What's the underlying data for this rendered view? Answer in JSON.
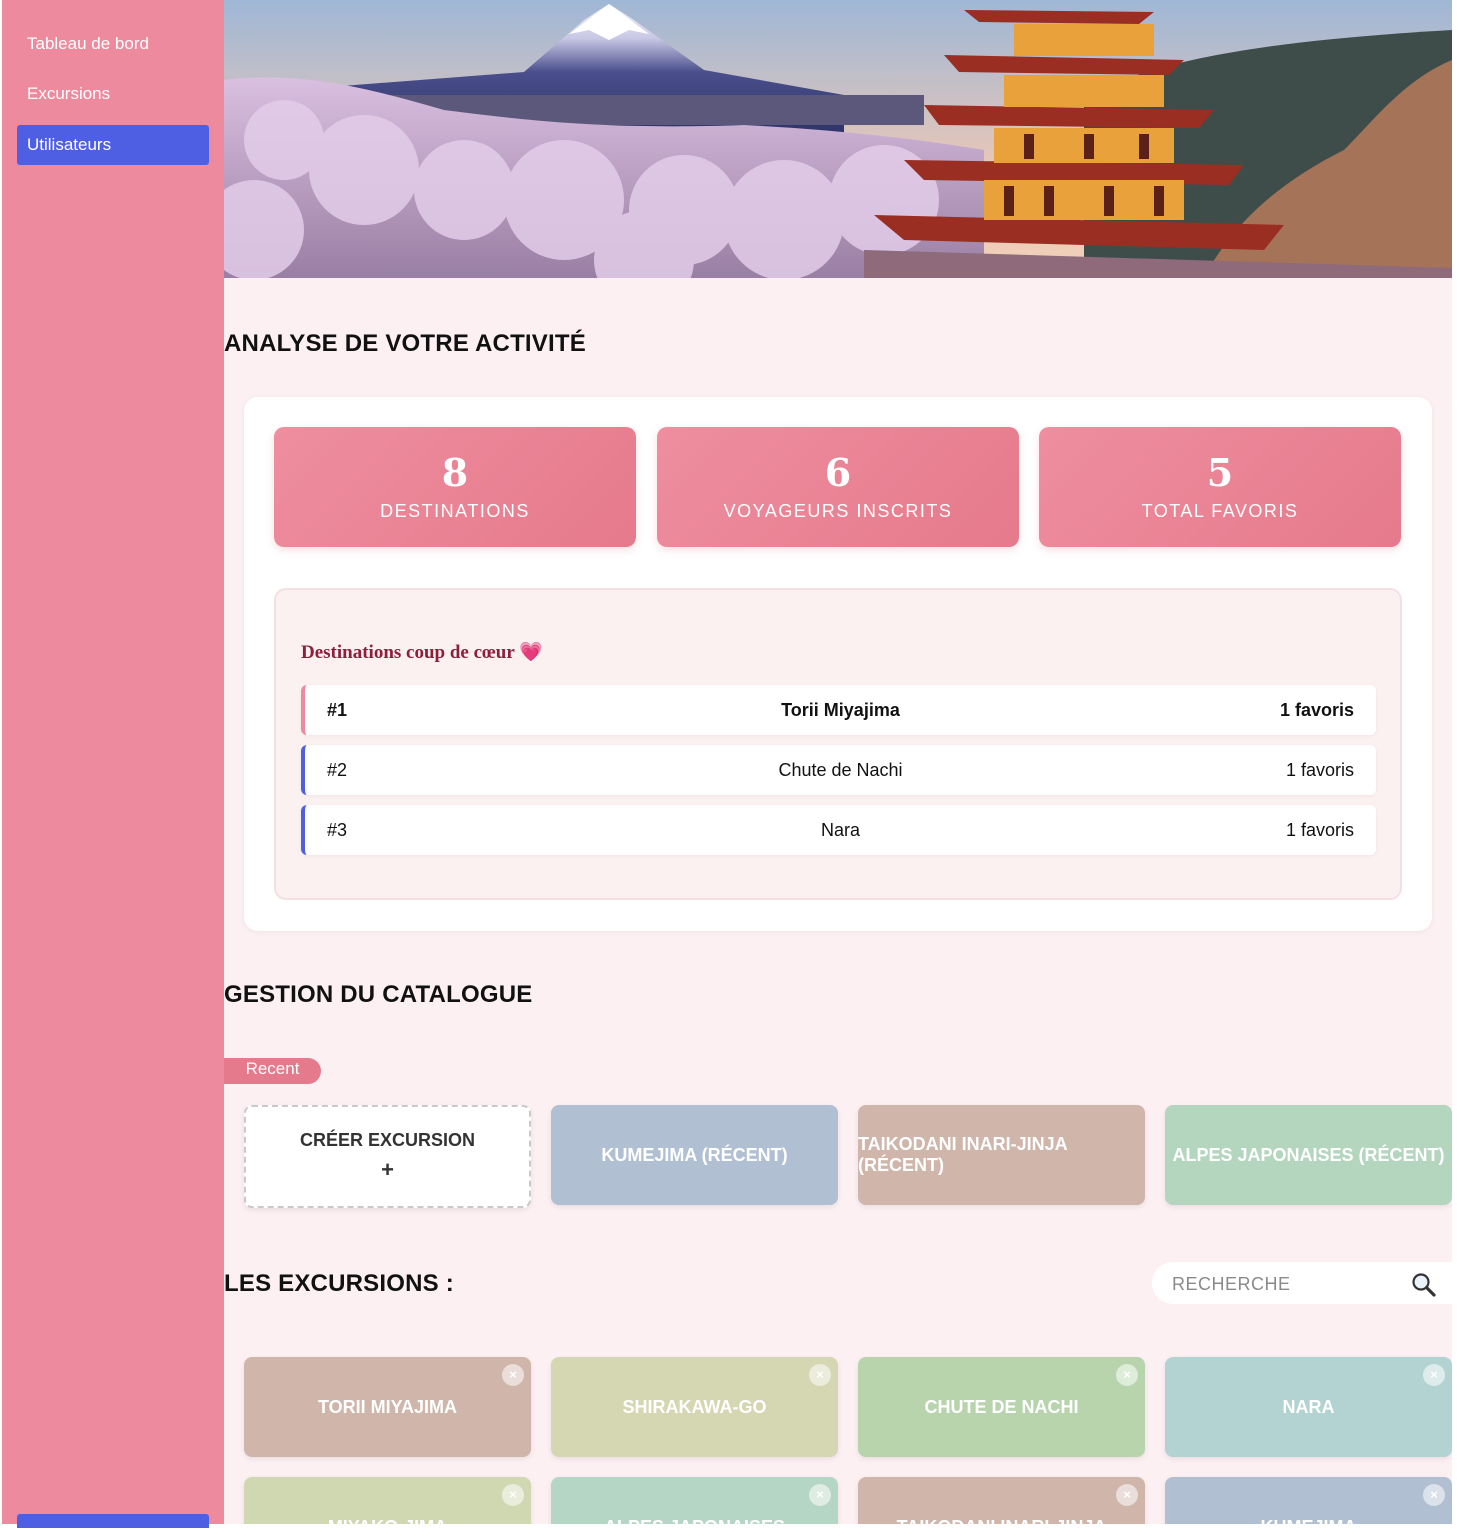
{
  "sidebar": {
    "items": [
      {
        "label": "Tableau de bord"
      },
      {
        "label": "Excursions"
      },
      {
        "label": "Utilisateurs",
        "active": true
      }
    ]
  },
  "analysis": {
    "title": "ANALYSE DE VOTRE ACTIVITÉ",
    "stats": [
      {
        "value": "8",
        "label": "DESTINATIONS"
      },
      {
        "value": "6",
        "label": "VOYAGEURS INSCRITS"
      },
      {
        "value": "5",
        "label": "TOTAL FAVORIS"
      }
    ],
    "favorites": {
      "title": "Destinations coup de cœur 💗",
      "rows": [
        {
          "rank": "#1",
          "name": "Torii Miyajima",
          "count": "1 favoris"
        },
        {
          "rank": "#2",
          "name": "Chute de Nachi",
          "count": "1 favoris"
        },
        {
          "rank": "#3",
          "name": "Nara",
          "count": "1 favoris"
        }
      ]
    }
  },
  "catalogue": {
    "title": "GESTION DU CATALOGUE",
    "tag": "Recent",
    "create": {
      "label": "Créer excursion",
      "plus": "+"
    },
    "recent": [
      {
        "label": "Kumejima (Récent)",
        "color": "#b0bfd2"
      },
      {
        "label": "Taikodani Inari-Jinja (Récent)",
        "color": "#cfb5aa"
      },
      {
        "label": "Alpes Japonaises (Récent)",
        "color": "#b5d6be"
      }
    ]
  },
  "excursions": {
    "title": "LES EXCURSIONS :",
    "search_placeholder": "Recherche",
    "search_icon": "magnifier-icon",
    "close_glyph": "×",
    "cards": [
      {
        "label": "Torii Miyajima",
        "color": "#cfb5aa"
      },
      {
        "label": "Shirakawa-go",
        "color": "#d5d6b2"
      },
      {
        "label": "Chute de Nachi",
        "color": "#b7d4ad"
      },
      {
        "label": "Nara",
        "color": "#b3d3d3"
      },
      {
        "label": "Miyako-jima",
        "color": "#d0d8b2"
      },
      {
        "label": "Alpes Japonaises",
        "color": "#b5d6c4"
      },
      {
        "label": "Taikodani Inari-Jinja",
        "color": "#cfb5aa"
      },
      {
        "label": "Kumejima",
        "color": "#b0bfd2"
      }
    ]
  }
}
